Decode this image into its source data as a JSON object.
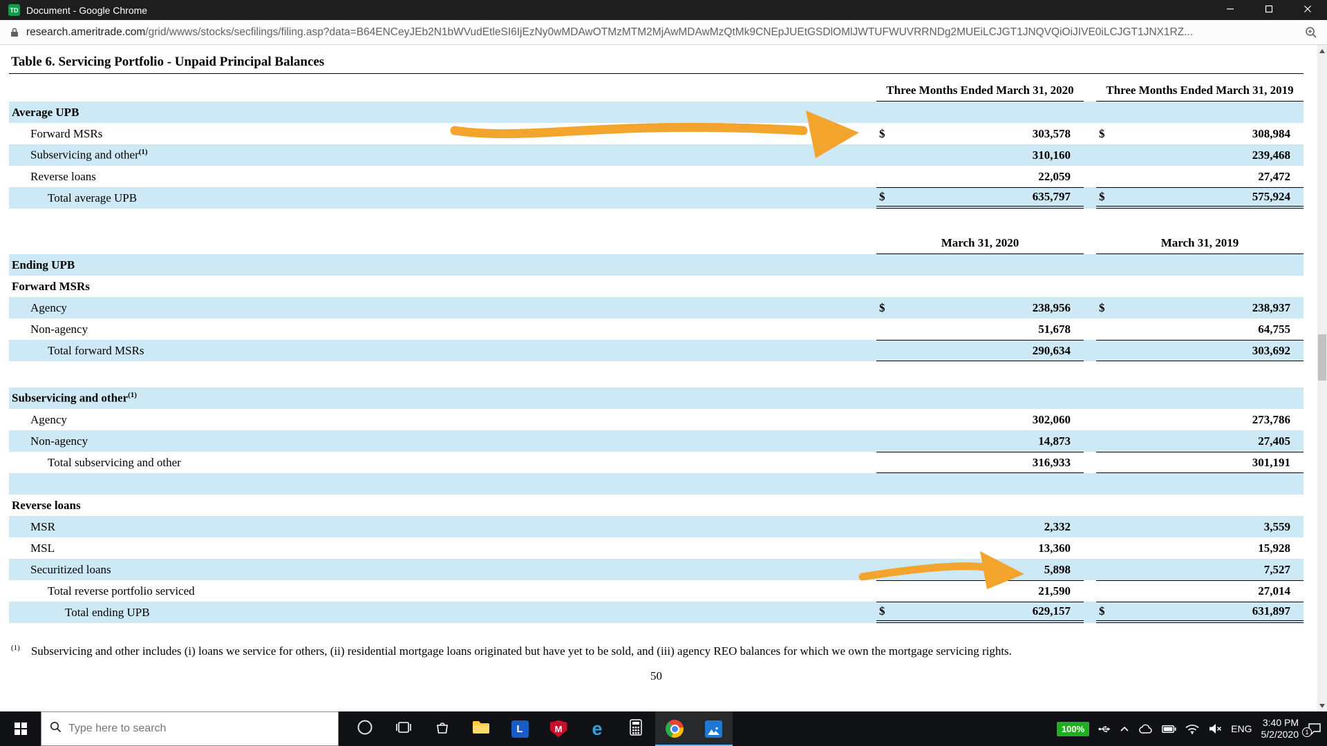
{
  "colors": {
    "row_highlight_blue": "#cee9f6",
    "annotation_orange": "#f2a42c",
    "tray_percent_green": "#1fae1f",
    "titlebar_bg": "#1e1e1e",
    "taskbar_bg": "#0f1114"
  },
  "titlebar": {
    "favicon": "TD",
    "title": "Document - Google Chrome"
  },
  "addressbar": {
    "domain": "research.ameritrade.com",
    "path": "/grid/wwws/stocks/secfilings/filing.asp?data=B64ENCeyJEb2N1bWVudEtleSI6IjEzNy0wMDAwOTMzMTM2MjAwMDAwMzQtMk9CNEpJUEtGSDlOMlJWTUFWUVRRNDg2MUEiLCJGT1JNQVQiOiJIVE0iLCJGT1JNX1RZ..."
  },
  "doc": {
    "title": "Table 6. Servicing Portfolio - Unpaid Principal Balances",
    "s1": {
      "h1": "Three Months Ended March 31, 2020",
      "h2": "Three Months Ended March 31, 2019",
      "rows": [
        {
          "label": "Average UPB"
        },
        {
          "label": "Forward MSRs",
          "d1": "$",
          "v1": "303,578",
          "d2": "$",
          "v2": "308,984"
        },
        {
          "label": "Subservicing and other",
          "sup": "(1)",
          "v1": "310,160",
          "v2": "239,468"
        },
        {
          "label": "Reverse loans",
          "v1": "22,059",
          "v2": "27,472"
        },
        {
          "label": "Total average UPB",
          "d1": "$",
          "v1": "635,797",
          "d2": "$",
          "v2": "575,924"
        }
      ]
    },
    "s2": {
      "h1": "March 31, 2020",
      "h2": "March 31, 2019",
      "rows": [
        {
          "label": "Ending UPB"
        },
        {
          "label": "Forward MSRs"
        },
        {
          "label": "Agency",
          "d1": "$",
          "v1": "238,956",
          "d2": "$",
          "v2": "238,937"
        },
        {
          "label": "Non-agency",
          "v1": "51,678",
          "v2": "64,755"
        },
        {
          "label": "Total forward MSRs",
          "v1": "290,634",
          "v2": "303,692"
        },
        {
          "label": ""
        },
        {
          "label": "Subservicing and other",
          "sup": "(1)"
        },
        {
          "label": "Agency",
          "v1": "302,060",
          "v2": "273,786"
        },
        {
          "label": "Non-agency",
          "v1": "14,873",
          "v2": "27,405"
        },
        {
          "label": "Total subservicing and other",
          "v1": "316,933",
          "v2": "301,191"
        },
        {
          "label": ""
        },
        {
          "label": "Reverse loans"
        },
        {
          "label": "MSR",
          "v1": "2,332",
          "v2": "3,559"
        },
        {
          "label": "MSL",
          "v1": "13,360",
          "v2": "15,928"
        },
        {
          "label": "Securitized loans",
          "v1": "5,898",
          "v2": "7,527"
        },
        {
          "label": "Total reverse portfolio serviced",
          "v1": "21,590",
          "v2": "27,014"
        },
        {
          "label": "Total ending UPB",
          "d1": "$",
          "v1": "629,157",
          "d2": "$",
          "v2": "631,897"
        }
      ]
    },
    "footnote_marker": "(1)",
    "footnote": "Subservicing and other includes (i) loans we service for others, (ii) residential mortgage loans originated but have yet to be sold, and (iii) agency REO balances for which we own the mortgage servicing rights.",
    "page_number": "50"
  },
  "taskbar": {
    "search_placeholder": "Type here to search",
    "app_glyphs": {
      "l_app": "L",
      "mcafee": "M",
      "edge": "e"
    },
    "apps": [
      "cortana",
      "task-view",
      "store",
      "file-explorer",
      "l-app",
      "mcafee",
      "edge",
      "calculator",
      "chrome",
      "photos"
    ],
    "tray": {
      "percent": "100%",
      "language": "ENG",
      "time": "3:40 PM",
      "date": "5/2/2020",
      "notification_count": "1"
    }
  }
}
